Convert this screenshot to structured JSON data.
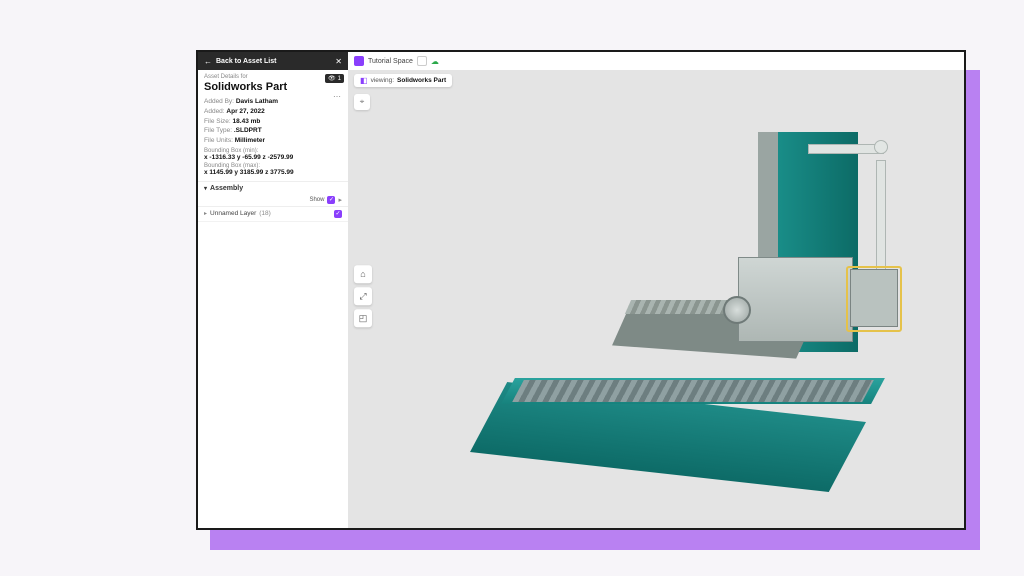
{
  "header": {
    "back_label": "Back to Asset List"
  },
  "asset": {
    "details_for": "Asset Details for",
    "title": "Solidworks Part",
    "views": "1",
    "meta": {
      "added_by_lbl": "Added By:",
      "added_by": "Davis Latham",
      "added_lbl": "Added:",
      "added": "Apr 27, 2022",
      "filesize_lbl": "File Size:",
      "filesize": "18.43 mb",
      "filetype_lbl": "File Type:",
      "filetype": ".SLDPRT",
      "fileunits_lbl": "File Units:",
      "fileunits": "Millimeter"
    },
    "bbox_min_lbl": "Bounding Box (min):",
    "bbox_min": "x -1316.33  y -65.99  z -2579.99",
    "bbox_max_lbl": "Bounding Box (max):",
    "bbox_max": "x 1145.99  y 3185.99  z 3775.99"
  },
  "assembly": {
    "title": "Assembly",
    "show_label": "Show",
    "layer_name": "Unnamed Layer",
    "layer_count": "(18)"
  },
  "breadcrumb": {
    "space": "Tutorial Space"
  },
  "viewing": {
    "prefix": "viewing:",
    "name": "Solidworks Part"
  }
}
